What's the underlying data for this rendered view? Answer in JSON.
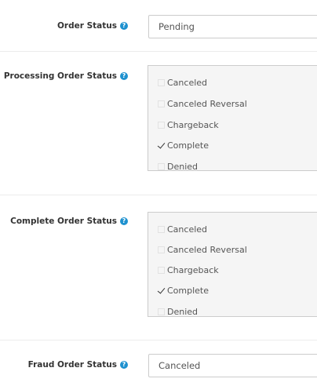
{
  "order_status": {
    "label": "Order Status",
    "value": "Pending"
  },
  "processing_order_status": {
    "label": "Processing Order Status",
    "options": [
      {
        "label": "Canceled",
        "checked": false
      },
      {
        "label": "Canceled Reversal",
        "checked": false
      },
      {
        "label": "Chargeback",
        "checked": false
      },
      {
        "label": "Complete",
        "checked": true
      },
      {
        "label": "Denied",
        "checked": false
      }
    ]
  },
  "complete_order_status": {
    "label": "Complete Order Status",
    "options": [
      {
        "label": "Canceled",
        "checked": false
      },
      {
        "label": "Canceled Reversal",
        "checked": false
      },
      {
        "label": "Chargeback",
        "checked": false
      },
      {
        "label": "Complete",
        "checked": true
      },
      {
        "label": "Denied",
        "checked": false
      }
    ]
  },
  "fraud_order_status": {
    "label": "Fraud Order Status",
    "value": "Canceled"
  },
  "help_icon_glyph": "?",
  "help_icon_color": "#1e91cf"
}
